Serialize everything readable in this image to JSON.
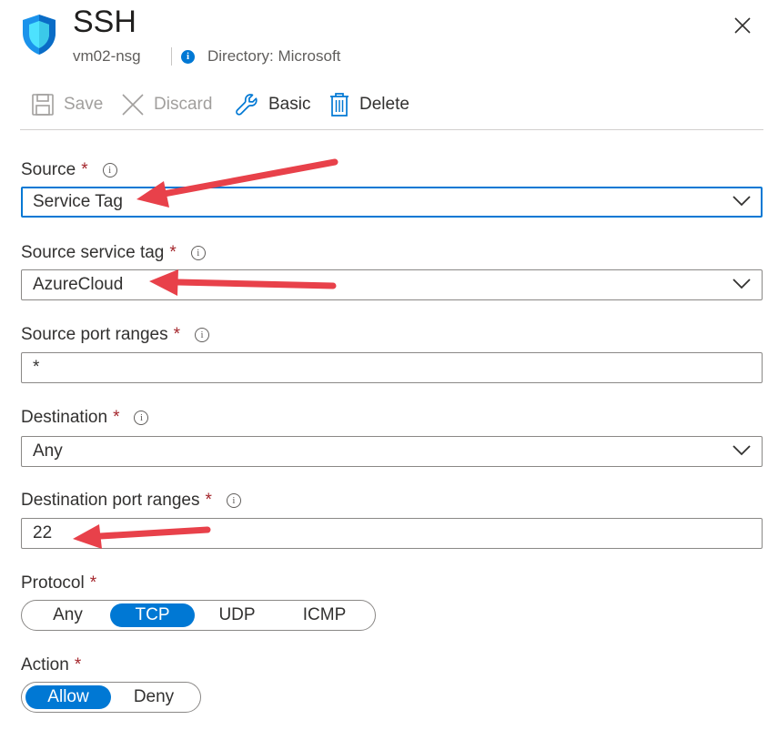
{
  "header": {
    "title": "SSH",
    "resource": "vm02-nsg",
    "directory": "Directory: Microsoft",
    "icons": {
      "shield": "shield-icon",
      "info": "info-icon",
      "close": "close-icon"
    }
  },
  "toolbar": {
    "save_label": "Save",
    "discard_label": "Discard",
    "basic_label": "Basic",
    "delete_label": "Delete"
  },
  "form": {
    "source": {
      "label": "Source",
      "value": "Service Tag"
    },
    "source_service_tag": {
      "label": "Source service tag",
      "value": "AzureCloud"
    },
    "source_port_ranges": {
      "label": "Source port ranges",
      "value": "*"
    },
    "destination": {
      "label": "Destination",
      "value": "Any"
    },
    "destination_port_ranges": {
      "label": "Destination port ranges",
      "value": "22"
    },
    "protocol": {
      "label": "Protocol",
      "options": [
        "Any",
        "TCP",
        "UDP",
        "ICMP"
      ],
      "selected": "TCP"
    },
    "action": {
      "label": "Action",
      "options": [
        "Allow",
        "Deny"
      ],
      "selected": "Allow"
    },
    "required_marker": "*"
  },
  "colors": {
    "accent": "#0078d4",
    "required": "#a4262c",
    "annotation_arrow": "#e8414a"
  }
}
